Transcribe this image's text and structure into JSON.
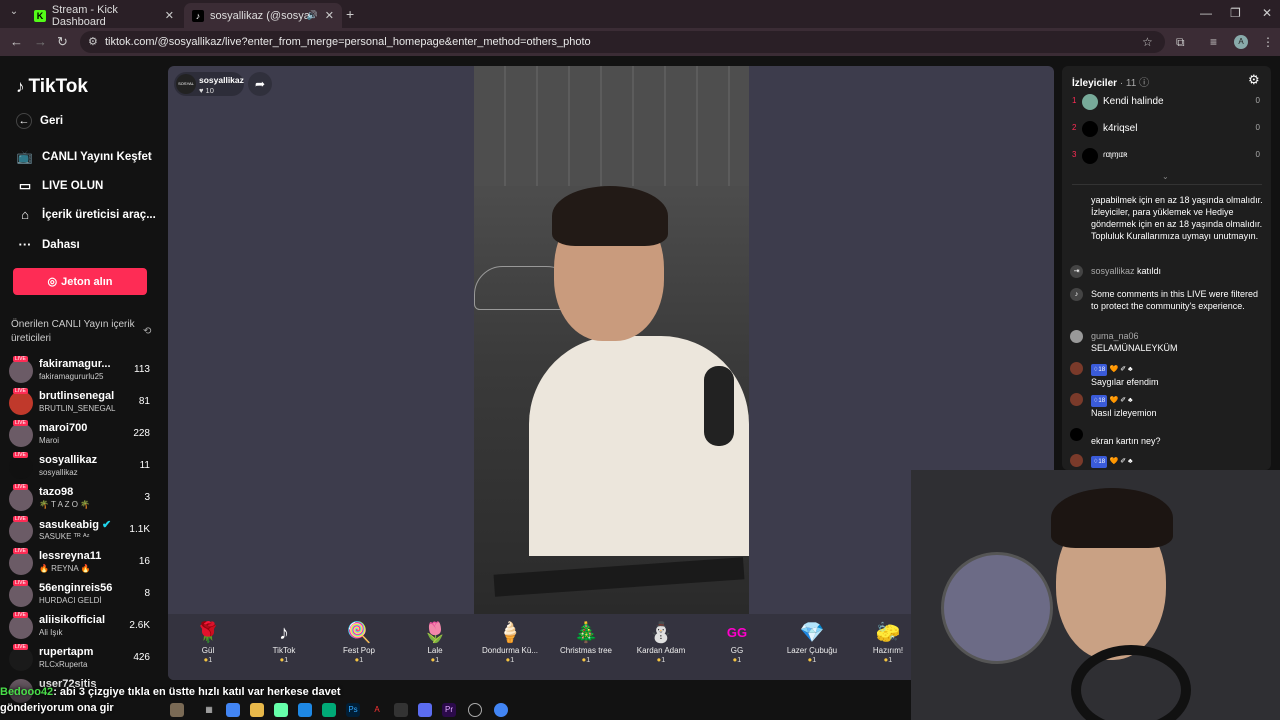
{
  "browser": {
    "tabs": [
      {
        "title": "Stream - Kick Dashboard",
        "icon": "kick-icon"
      },
      {
        "title": "sosyallikaz (@sosyallikaz) C",
        "icon": "tiktok-icon"
      }
    ],
    "url": "tiktok.com/@sosyallikaz/live?enter_from_merge=personal_homepage&enter_method=others_photo",
    "profile_initial": "A"
  },
  "sidebar": {
    "logo": "TikTok",
    "back_label": "Geri",
    "nav": [
      {
        "label": "CANLI Yayını Keşfet",
        "icon": "tv-icon"
      },
      {
        "label": "LIVE OLUN",
        "icon": "camera-icon"
      },
      {
        "label": "İçerik üreticisi araç...",
        "icon": "home-icon"
      },
      {
        "label": "Dahası",
        "icon": "more-icon"
      }
    ],
    "coins_button": "Jeton alın",
    "recommended_title": "Önerilen CANLI Yayın içerik üreticileri",
    "creators": [
      {
        "name": "fakiramagur...",
        "sub": "fakiramagururlu25",
        "count": "113"
      },
      {
        "name": "brutlinsenegal",
        "sub": "BRUTLIN_SENEGAL",
        "count": "81"
      },
      {
        "name": "maroi700",
        "sub": "Maroi",
        "count": "228"
      },
      {
        "name": "sosyallikaz",
        "sub": "sosyallikaz",
        "count": "11"
      },
      {
        "name": "tazo98",
        "sub": "🌴 T A Z O 🌴",
        "count": "3"
      },
      {
        "name": "sasukeabig",
        "sub": "SASUKE ᵀᴿ ᴬᶻ",
        "count": "1.1K"
      },
      {
        "name": "lessreyna11",
        "sub": "🔥 REYNA 🔥",
        "count": "16"
      },
      {
        "name": "56enginreis56",
        "sub": "HURDACI GELDİ",
        "count": "8"
      },
      {
        "name": "aliisikofficial",
        "sub": "Ali Işık",
        "count": "2.6K"
      },
      {
        "name": "rupertapm",
        "sub": "RLCxRuperta",
        "count": "426"
      },
      {
        "name": "user72sitis",
        "sub": "",
        "count": ""
      }
    ]
  },
  "stream": {
    "host_name": "sosyallikaz",
    "host_likes": "♥ 10",
    "gifts": [
      {
        "name": "Gül",
        "icon": "🌹",
        "price": "1"
      },
      {
        "name": "TikTok",
        "icon": "♪",
        "price": "1"
      },
      {
        "name": "Fest Pop",
        "icon": "🍭",
        "price": "1"
      },
      {
        "name": "Lale",
        "icon": "🌷",
        "price": "1"
      },
      {
        "name": "Dondurma Kü...",
        "icon": "🍦",
        "price": "1"
      },
      {
        "name": "Christmas tree",
        "icon": "🎄",
        "price": "1"
      },
      {
        "name": "Kardan Adam",
        "icon": "⛄",
        "price": "1"
      },
      {
        "name": "GG",
        "icon": "GG",
        "price": "1"
      },
      {
        "name": "Lazer Çubuğu",
        "icon": "💎",
        "price": "1"
      },
      {
        "name": "Hazırım!",
        "icon": "🧽",
        "price": "1"
      }
    ]
  },
  "chat": {
    "title": "İzleyiciler",
    "viewer_count": "· 11",
    "viewers": [
      {
        "rank": "1",
        "name": "Kendi halinde",
        "score": "0"
      },
      {
        "rank": "2",
        "name": "k4riqsel",
        "score": "0"
      },
      {
        "rank": "3",
        "name": "ɾɑʅɱɩɪʀ",
        "score": "0"
      }
    ],
    "messages": [
      {
        "user": "",
        "text": "yapabilmek için en az 18 yaşında olmalıdır. İzleyiciler, para yüklemek ve Hediye göndermek için en az 18 yaşında olmalıdır. Topluluk Kurallarımıza uymayı unutmayın."
      },
      {
        "user": "sosyallikaz",
        "text": "katıldı"
      },
      {
        "user": "",
        "text": "Some comments in this LIVE were filtered to protect the community's experience."
      },
      {
        "user": "guma_na06",
        "text": "SELAMÜNALEYKÜM"
      },
      {
        "user": "",
        "text": "Saygılar efendim"
      },
      {
        "user": "",
        "text": "Nasıl izleyemion"
      },
      {
        "user": "",
        "text": "ekran kartın ney?"
      }
    ]
  },
  "overlay": {
    "user": "Bedooo42",
    "text": ": abi 3 çizgiye tıkla en üstte hızlı katıl var herkese davet gönderiyorum ona gir"
  }
}
